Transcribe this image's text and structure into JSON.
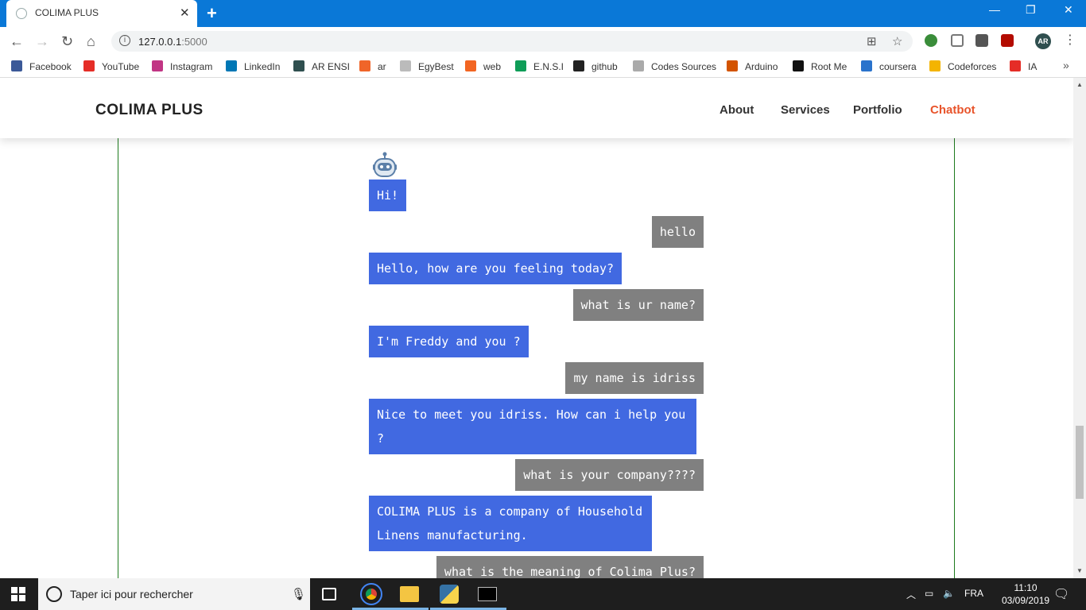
{
  "browser": {
    "tab_title": "COLIMA PLUS",
    "tab_close": "✕",
    "new_tab": "+",
    "url_host": "127.0.0.1",
    "url_port": ":5000",
    "window_minimize": "—",
    "window_restore": "❐",
    "window_close": "✕",
    "profile_initials": "AR"
  },
  "bookmarks": [
    {
      "label": "Facebook",
      "color": "#3b5998"
    },
    {
      "label": "YouTube",
      "color": "#e52d27"
    },
    {
      "label": "Instagram",
      "color": "#c13584"
    },
    {
      "label": "LinkedIn",
      "color": "#0077b5"
    },
    {
      "label": "AR ENSI",
      "color": "#2f4f4f"
    },
    {
      "label": "ar",
      "color": "#f06529"
    },
    {
      "label": "EgyBest",
      "color": "#bbbbbb"
    },
    {
      "label": "web",
      "color": "#f26522"
    },
    {
      "label": "E.N.S.I",
      "color": "#0f9d58"
    },
    {
      "label": "github",
      "color": "#222222"
    },
    {
      "label": "Codes Sources",
      "color": "#aaaaaa"
    },
    {
      "label": "Arduino",
      "color": "#d35400"
    },
    {
      "label": "Root Me",
      "color": "#111111"
    },
    {
      "label": "coursera",
      "color": "#2a73cc"
    },
    {
      "label": "Codeforces",
      "color": "#f4b400"
    },
    {
      "label": "IA",
      "color": "#e52d27"
    }
  ],
  "site": {
    "brand": "COLIMA PLUS",
    "nav": {
      "about": "About",
      "services": "Services",
      "portfolio": "Portfolio",
      "chatbot": "Chatbot"
    },
    "accent_color": "#e8542b"
  },
  "chat": {
    "bot_color": "#4169e1",
    "user_color": "#808080",
    "messages": [
      {
        "from": "bot",
        "text": "Hi!"
      },
      {
        "from": "user",
        "text": "hello"
      },
      {
        "from": "bot",
        "text": "Hello, how are you feeling today?"
      },
      {
        "from": "user",
        "text": "what is ur name?"
      },
      {
        "from": "bot",
        "text": "I'm Freddy and you ?"
      },
      {
        "from": "user",
        "text": "my name is idriss"
      },
      {
        "from": "bot",
        "text": "Nice to meet you idriss. How can i help you ?"
      },
      {
        "from": "user",
        "text": "what is your company????"
      },
      {
        "from": "bot",
        "text": "COLIMA PLUS is a company of Household Linens manufacturing."
      },
      {
        "from": "user",
        "text": "what is the meaning of Colima Plus?"
      }
    ]
  },
  "taskbar": {
    "search_placeholder": "Taper ici pour rechercher",
    "language": "FRA",
    "time": "11:10",
    "date": "03/09/2019"
  }
}
